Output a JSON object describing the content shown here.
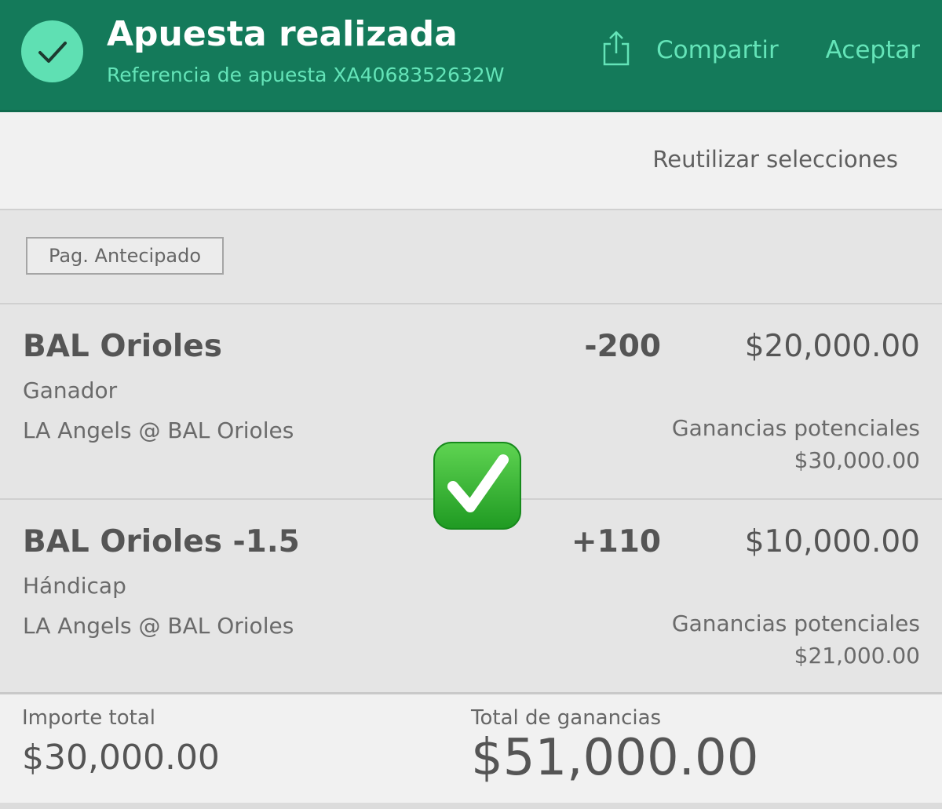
{
  "header": {
    "title": "Apuesta realizada",
    "reference": "Referencia de apuesta XA4068352632W",
    "share_label": "Compartir",
    "accept_label": "Aceptar",
    "icons": {
      "status": "checkmark-icon",
      "share": "share-icon"
    },
    "colors": {
      "background": "#147a5a",
      "accent": "#64e4b8",
      "check_circle": "#5fe0b3"
    }
  },
  "reuse": {
    "label": "Reutilizar selecciones"
  },
  "tag": {
    "label": "Pag. Antecipado"
  },
  "selections": [
    {
      "title": "BAL Orioles",
      "odds": "-200",
      "stake": "$20,000.00",
      "market": "Ganador",
      "event": "LA Angels @ BAL Orioles",
      "potential_label": "Ganancias potenciales",
      "potential_value": "$30,000.00"
    },
    {
      "title": "BAL Orioles -1.5",
      "odds": "+110",
      "stake": "$10,000.00",
      "market": "Hándicap",
      "event": "LA Angels @ BAL Orioles",
      "potential_label": "Ganancias potenciales",
      "potential_value": "$21,000.00"
    }
  ],
  "overlay": {
    "icon": "green-checkmark-emoji-icon",
    "color": "#2cb52a"
  },
  "footer": {
    "total_label": "Importe total",
    "total_value": "$30,000.00",
    "winnings_label": "Total de ganancias",
    "winnings_value": "$51,000.00"
  }
}
